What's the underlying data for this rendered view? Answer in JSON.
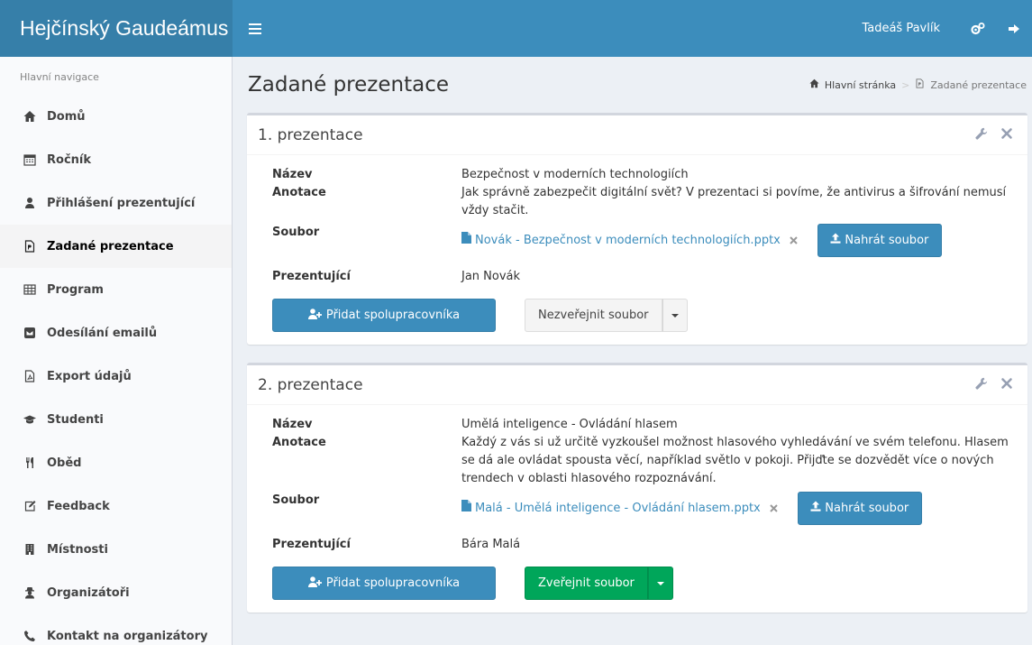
{
  "app": {
    "title": "Hejčínský Gaudeámus"
  },
  "header": {
    "user_name": "Tadeáš Pavlík",
    "settings_icon": "cogs-icon",
    "logout_icon": "sign-out-icon"
  },
  "sidebar": {
    "header": "Hlavní navigace",
    "items": [
      {
        "label": "Domů",
        "icon": "home-icon"
      },
      {
        "label": "Ročník",
        "icon": "calendar-icon"
      },
      {
        "label": "Přihlášení prezentující",
        "icon": "user-icon"
      },
      {
        "label": "Zadané prezentace",
        "icon": "file-powerpoint-icon"
      },
      {
        "label": "Program",
        "icon": "table-icon"
      },
      {
        "label": "Odesílání emailů",
        "icon": "envelope-square-icon"
      },
      {
        "label": "Export údajů",
        "icon": "file-pdf-icon"
      },
      {
        "label": "Studenti",
        "icon": "graduation-cap-icon"
      },
      {
        "label": "Oběd",
        "icon": "cutlery-icon"
      },
      {
        "label": "Feedback",
        "icon": "edit-icon"
      },
      {
        "label": "Místnosti",
        "icon": "building-icon"
      },
      {
        "label": "Organizátoři",
        "icon": "user-secret-icon"
      },
      {
        "label": "Kontakt na organizátory",
        "icon": "phone-icon"
      }
    ],
    "active_index": 3
  },
  "page": {
    "title": "Zadané prezentace",
    "breadcrumb": {
      "home": "Hlavní stránka",
      "current": "Zadané prezentace"
    }
  },
  "labels": {
    "name": "Název",
    "annotation": "Anotace",
    "file": "Soubor",
    "presenter": "Prezentující",
    "upload": "Nahrát soubor",
    "add_collaborator": "Přidat spolupracovníka"
  },
  "presentations": [
    {
      "title": "1. prezentace",
      "name": "Bezpečnost v moderních technologiích",
      "annotation": "Jak správně zabezpečit digitální svět? V prezentaci si povíme, že antivirus a šifrování nemusí vždy stačit.",
      "file": "Novák - Bezpečnost v moderních technologiích.pptx",
      "presenter": "Jan Novák",
      "publish_label": "Nezveřejnit soubor",
      "publish_style": "default"
    },
    {
      "title": "2. prezentace",
      "name": "Umělá inteligence - Ovládání hlasem",
      "annotation": "Každý z vás si už určitě vyzkoušel možnost hlasového vyhledávání ve svém telefonu. Hlasem se dá ale ovládat spousta věcí, například světlo v pokoji. Přijďte se dozvědět více o nových trendech v oblasti hlasového rozpoznávání.",
      "file": "Malá - Umělá inteligence - Ovládání hlasem.pptx",
      "presenter": "Bára Malá",
      "publish_label": "Zveřejnit soubor",
      "publish_style": "success"
    }
  ],
  "colors": {
    "brand": "#367fa9",
    "navbar": "#3c8dbc",
    "primary": "#3c8dbc",
    "success": "#00a65a",
    "link": "#3c8dbc"
  }
}
